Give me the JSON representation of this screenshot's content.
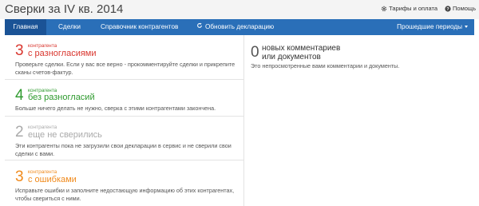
{
  "header": {
    "title": "Сверки за IV кв. 2014",
    "links": [
      {
        "label": "Тарифы и оплата",
        "icon": "gear-icon"
      },
      {
        "label": "Помощь",
        "icon": "question-icon"
      }
    ]
  },
  "nav": {
    "items": [
      "Главная",
      "Сделки",
      "Справочник контрагентов"
    ],
    "refresh_label": "Обновить декларацию",
    "periods_label": "Прошедшие периоды",
    "active_index": 0,
    "colors": {
      "bar": "#2a6fb8",
      "active": "#1b5396"
    }
  },
  "cards": [
    {
      "count": "3",
      "small": "контрагента",
      "big": "с разногласиями",
      "color": "#d9362e",
      "description": "Проверьте сделки. Если у вас все верно - прокомментируйте сделки и прикрепите сканы счетов-фактур."
    },
    {
      "count": "4",
      "small": "контрагента",
      "big": "без разногласий",
      "color": "#2e9a2e",
      "description": "Больше ничего делать не нужно, сверка с этими контрагентами закончена."
    },
    {
      "count": "2",
      "small": "контрагента",
      "big": "еще не сверились",
      "color": "#aaaaaa",
      "description": "Эти контрагенты пока не загрузили свои декларации в сервис и не сверили свои сделки с вами."
    },
    {
      "count": "3",
      "small": "контрагента",
      "big": "с ошибками",
      "color": "#f08a1c",
      "description": "Исправьте ошибки и заполните недостающую информацию об этих контрагентах, чтобы свериться с ними."
    }
  ],
  "comments": {
    "count": "0",
    "title_line1": "новых комментариев",
    "title_line2": "или документов",
    "description": "Это непросмотренные вами комментарии и документы."
  }
}
